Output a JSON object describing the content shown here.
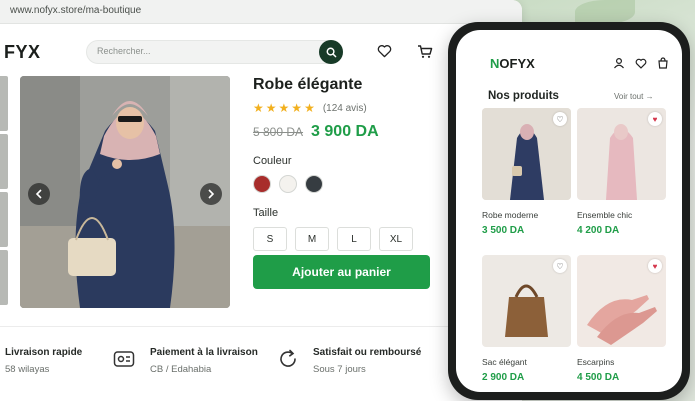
{
  "browser": {
    "url": "www.nofyx.store/ma-boutique",
    "logo": "FYX",
    "search_placeholder": "Rechercher..."
  },
  "product": {
    "title": "Robe élégante",
    "rating": 5,
    "reviews": "(124 avis)",
    "old_price": "5 800 DA",
    "new_price": "3 900 DA",
    "color_label": "Couleur",
    "colors": [
      "#a82d2b",
      "#f4f2ee",
      "#363c41"
    ],
    "size_label": "Taille",
    "sizes": [
      "S",
      "M",
      "L",
      "XL"
    ],
    "add_to_cart": "Ajouter au panier"
  },
  "features": [
    {
      "title": "Livraison rapide",
      "subtitle": "58 wilayas",
      "icon": "truck-icon"
    },
    {
      "title": "Paiement à la livraison",
      "subtitle": "CB / Edahabia",
      "icon": "payment-icon"
    },
    {
      "title": "Satisfait ou remboursé",
      "subtitle": "Sous 7 jours",
      "icon": "refresh-icon"
    }
  ],
  "mobile": {
    "logo_accent": "N",
    "logo_rest": "OFYX",
    "section_title": "Nos produits",
    "see_all": "Voir tout",
    "products": [
      {
        "name": "Robe moderne",
        "price": "3 500 DA",
        "favorited": false
      },
      {
        "name": "Ensemble chic",
        "price": "4 200 DA",
        "favorited": true
      },
      {
        "name": "Sac élégant",
        "price": "2 900 DA",
        "favorited": false
      },
      {
        "name": "Escarpins",
        "price": "4 500 DA",
        "favorited": true
      }
    ]
  },
  "colors": {
    "accent": "#1f9d48",
    "dark": "#173a27"
  }
}
